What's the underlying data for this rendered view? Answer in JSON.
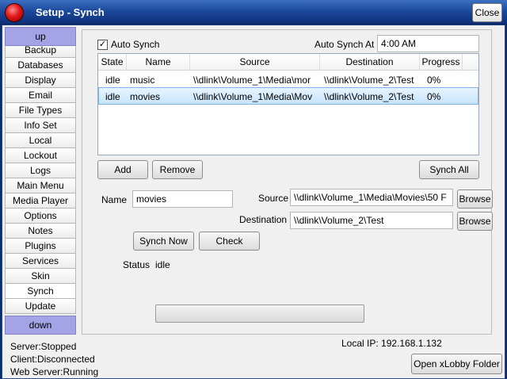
{
  "window": {
    "title": "Setup - Synch",
    "close_label": "Close"
  },
  "sidebar": {
    "up_label": "up",
    "down_label": "down",
    "items": [
      {
        "label": "Backup"
      },
      {
        "label": "Databases"
      },
      {
        "label": "Display"
      },
      {
        "label": "Email"
      },
      {
        "label": "File Types"
      },
      {
        "label": "Info Set"
      },
      {
        "label": "Local"
      },
      {
        "label": "Lockout"
      },
      {
        "label": "Logs"
      },
      {
        "label": "Main Menu"
      },
      {
        "label": "Media Player"
      },
      {
        "label": "Options"
      },
      {
        "label": "Notes"
      },
      {
        "label": "Plugins"
      },
      {
        "label": "Services"
      },
      {
        "label": "Skin"
      },
      {
        "label": "Synch"
      },
      {
        "label": "Update"
      }
    ],
    "selected": "Synch"
  },
  "synch": {
    "auto_synch_label": "Auto Synch",
    "auto_synch_checked": true,
    "auto_synch_at_label": "Auto Synch At",
    "auto_synch_at_value": "4:00 AM",
    "table": {
      "headers": [
        "State",
        "Name",
        "Source",
        "Destination",
        "Progress"
      ],
      "rows": [
        {
          "state": "idle",
          "name": "music",
          "source": "\\\\dlink\\Volume_1\\Media\\mor",
          "destination": "\\\\dlink\\Volume_2\\Test",
          "progress": "0%"
        },
        {
          "state": "idle",
          "name": "movies",
          "source": "\\\\dlink\\Volume_1\\Media\\Mov",
          "destination": "\\\\dlink\\Volume_2\\Test",
          "progress": "0%",
          "selected": true
        }
      ]
    },
    "add_label": "Add",
    "remove_label": "Remove",
    "synch_all_label": "Synch All",
    "name_label": "Name",
    "name_value": "movies",
    "source_label": "Source",
    "source_value": "\\\\dlink\\Volume_1\\Media\\Movies\\50 F",
    "destination_label": "Destination",
    "destination_value": "\\\\dlink\\Volume_2\\Test",
    "browse_label": "Browse",
    "synch_now_label": "Synch Now",
    "check_label": "Check",
    "status_label": "Status",
    "status_value": "idle",
    "progress_value": 0
  },
  "footer": {
    "server_status": "Server:Stopped",
    "client_status": "Client:Disconnected",
    "web_server_status": "Web Server:Running",
    "local_ip": "Local IP: 192.168.1.132",
    "open_folder_label": "Open xLobby Folder"
  },
  "colors": {
    "titlebar": "#1d4a9c",
    "nav_arrow": "#a3a3e6",
    "selection": "#c6e3fb"
  }
}
